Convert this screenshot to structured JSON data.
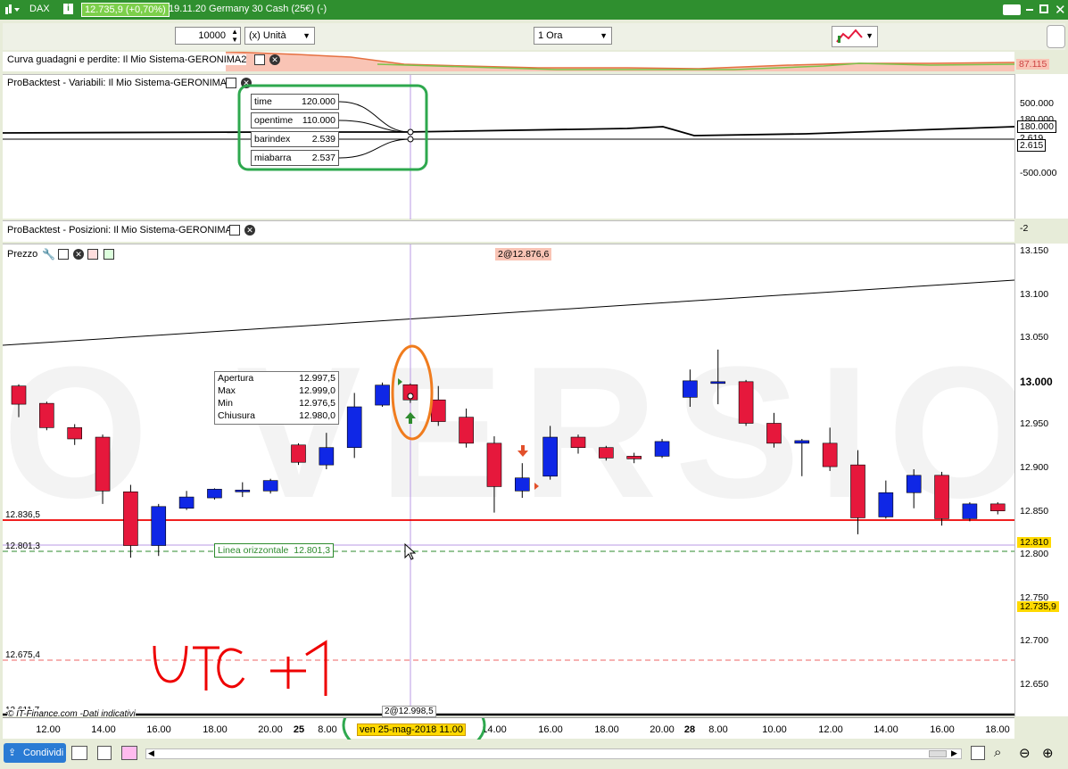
{
  "titlebar": {
    "symbol": "DAX",
    "info_icon": "info-icon",
    "price_badge": "12.735,9 (+0,70%)",
    "title": "19.11.20 Germany 30 Cash (25€) (-)"
  },
  "toolbar": {
    "quantity": "10000",
    "unit": "(x) Unità",
    "timeframe": "1 Ora"
  },
  "equity_panel": {
    "label": "Curva guadagni e perdite: Il Mio Sistema-GERONIMA2",
    "value_badge": "87.115"
  },
  "variables_panel": {
    "label": "ProBacktest - Variabili: Il Mio Sistema-GERONIMA2",
    "scale": [
      "500.000",
      "180.000",
      "180.000",
      "2.619",
      "2.615",
      "-500.000"
    ],
    "readouts": [
      {
        "name": "time",
        "value": "120.000"
      },
      {
        "name": "opentime",
        "value": "110.000"
      },
      {
        "name": "barindex",
        "value": "2.539"
      },
      {
        "name": "miabarra",
        "value": "2.537"
      }
    ]
  },
  "positions_panel": {
    "label": "ProBacktest - Posizioni: Il Mio Sistema-GERONIMA2",
    "scale": "-2"
  },
  "price_panel": {
    "label": "Prezzo",
    "order_label": "2@12.876,6",
    "hover": {
      "rows": [
        {
          "k": "Apertura",
          "v": "12.997,5"
        },
        {
          "k": "Max",
          "v": "12.999,0"
        },
        {
          "k": "Min",
          "v": "12.976,5"
        },
        {
          "k": "Chiusura",
          "v": "12.980,0"
        }
      ]
    },
    "hline_label": "Linea orizzontale",
    "hline_value": "12.801,3",
    "level_labels": [
      "12.836,5",
      "12.801,3",
      "12.675,4",
      "12.611,7"
    ],
    "badge_right_1": "12.810",
    "badge_right_2": "12.735,9",
    "source_text": "© IT-Finance.com -Dati indicativi",
    "order_bottom": "2@12.998,5",
    "annotation_text": "UTC+1",
    "y_ticks": [
      "13.150",
      "13.100",
      "13.050",
      "13.000",
      "12.950",
      "12.900",
      "12.850",
      "12.800",
      "12.750",
      "12.700",
      "12.650"
    ]
  },
  "chart_data": {
    "type": "candlestick",
    "ylim": [
      12600,
      13160
    ],
    "candles": [
      {
        "o": 12996,
        "c": 12975,
        "h": 12998,
        "l": 12960
      },
      {
        "o": 12976,
        "c": 12948,
        "h": 12978,
        "l": 12945
      },
      {
        "o": 12948,
        "c": 12935,
        "h": 12952,
        "l": 12928
      },
      {
        "o": 12937,
        "c": 12875,
        "h": 12940,
        "l": 12860
      },
      {
        "o": 12874,
        "c": 12812,
        "h": 12882,
        "l": 12798
      },
      {
        "o": 12812,
        "c": 12857,
        "h": 12860,
        "l": 12800
      },
      {
        "o": 12855,
        "c": 12868,
        "h": 12875,
        "l": 12853
      },
      {
        "o": 12867,
        "c": 12877,
        "h": 12878,
        "l": 12865
      },
      {
        "o": 12875,
        "c": 12876,
        "h": 12885,
        "l": 12868
      },
      {
        "o": 12875,
        "c": 12887,
        "h": 12889,
        "l": 12872
      },
      {
        "o": 12928,
        "c": 12908,
        "h": 12930,
        "l": 12905
      },
      {
        "o": 12905,
        "c": 12925,
        "h": 12942,
        "l": 12900
      },
      {
        "o": 12925,
        "c": 12972,
        "h": 12988,
        "l": 12913
      },
      {
        "o": 12974,
        "c": 12997,
        "h": 13000,
        "l": 12972
      },
      {
        "o": 12997.5,
        "c": 12980,
        "h": 12999,
        "l": 12976.5
      },
      {
        "o": 12980,
        "c": 12955,
        "h": 12996,
        "l": 12950
      },
      {
        "o": 12960,
        "c": 12930,
        "h": 12970,
        "l": 12925
      },
      {
        "o": 12930,
        "c": 12880,
        "h": 12938,
        "l": 12850
      },
      {
        "o": 12875,
        "c": 12890,
        "h": 12907,
        "l": 12867
      },
      {
        "o": 12892,
        "c": 12937,
        "h": 12950,
        "l": 12888
      },
      {
        "o": 12937,
        "c": 12925,
        "h": 12940,
        "l": 12918
      },
      {
        "o": 12925,
        "c": 12913,
        "h": 12927,
        "l": 12910
      },
      {
        "o": 12915,
        "c": 12912,
        "h": 12919,
        "l": 12907
      },
      {
        "o": 12915,
        "c": 12932,
        "h": 12935,
        "l": 12913
      },
      {
        "o": 12983,
        "c": 13002,
        "h": 13015,
        "l": 12972
      },
      {
        "o": 13000,
        "c": 13001,
        "h": 13038,
        "l": 12975
      },
      {
        "o": 13001,
        "c": 12953,
        "h": 13003,
        "l": 12950
      },
      {
        "o": 12953,
        "c": 12930,
        "h": 12965,
        "l": 12925
      },
      {
        "o": 12930,
        "c": 12933,
        "h": 12935,
        "l": 12892
      },
      {
        "o": 12930,
        "c": 12903,
        "h": 12948,
        "l": 12898
      },
      {
        "o": 12905,
        "c": 12844,
        "h": 12922,
        "l": 12825
      },
      {
        "o": 12845,
        "c": 12873,
        "h": 12887,
        "l": 12843
      },
      {
        "o": 12873,
        "c": 12893,
        "h": 12900,
        "l": 12855
      },
      {
        "o": 12893,
        "c": 12843,
        "h": 12897,
        "l": 12835
      },
      {
        "o": 12843,
        "c": 12860,
        "h": 12862,
        "l": 12840
      },
      {
        "o": 12860,
        "c": 12852,
        "h": 12862,
        "l": 12848
      }
    ],
    "x_ticks": [
      "12.00",
      "14.00",
      "16.00",
      "18.00",
      "20.00",
      "25",
      "8.00",
      "ven 25-mag-2018 11.00",
      "14.00",
      "16.00",
      "18.00",
      "20.00",
      "28",
      "8.00",
      "10.00",
      "12.00",
      "14.00",
      "16.00",
      "18.00"
    ]
  },
  "colors": {
    "up": "#0f27e6",
    "down": "#e6183c",
    "accent": "#2e8b2e"
  },
  "bottombar": {
    "share_label": "Condividi"
  }
}
